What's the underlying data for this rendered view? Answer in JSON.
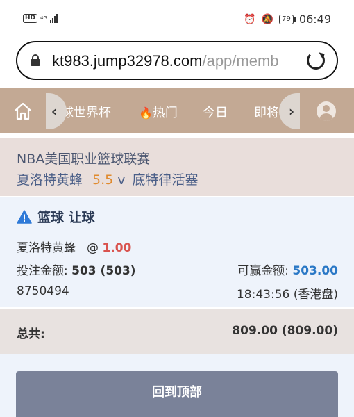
{
  "status_bar": {
    "hd": "HD",
    "network": "4G",
    "battery": "79",
    "time": "06:49"
  },
  "browser": {
    "url_host": "kt983.jump32978.com",
    "url_path": "/app/memb"
  },
  "nav": {
    "items": [
      "球世界杯",
      "热门",
      "今日",
      "即将"
    ]
  },
  "match": {
    "league": "NBA美国职业篮球联赛",
    "home_team": "夏洛特黄蜂",
    "line": "5.5",
    "vs": "v",
    "away_team": "底特律活塞"
  },
  "bet": {
    "title": "篮球 让球",
    "pick": "夏洛特黄蜂",
    "at": "@",
    "odds": "1.00",
    "stake_label": "投注金额:",
    "stake_value": "503 (503)",
    "win_label": "可赢金额:",
    "win_value": "503.00",
    "ticket_id": "8750494",
    "time": "18:43:56 (香港盘)"
  },
  "total": {
    "label": "总共:",
    "value": "809.00 (809.00)"
  },
  "back_to_top_label": "回到顶部",
  "colors": {
    "nav_bg": "#c3a994",
    "odds": "#d9534f",
    "line": "#e08a2e",
    "win": "#2a78c6",
    "button": "#7a8299"
  }
}
